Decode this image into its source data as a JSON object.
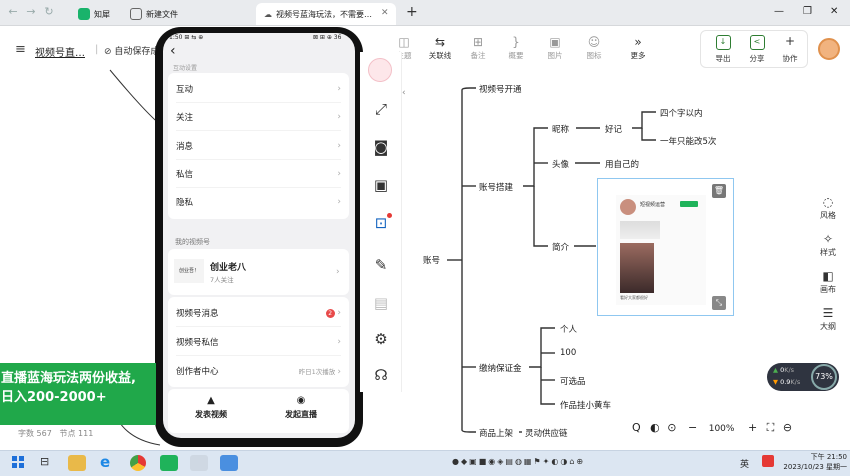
{
  "browser": {
    "tabs": [
      {
        "label": "知犀",
        "icon_color": "#19b36b"
      },
      {
        "label": "新建文件",
        "icon_color": "#666666"
      },
      {
        "label": "视频号蓝海玩法，不需要…",
        "icon_color": "#666666"
      }
    ],
    "new_tab": "+",
    "window_controls": [
      "—",
      "❐",
      "✕"
    ]
  },
  "doc": {
    "menu_icon": "≡",
    "title": "视频号直…",
    "saved": "自动保存成"
  },
  "toolbar": {
    "items": [
      {
        "label": "主题",
        "glyph": "◫"
      },
      {
        "label": "关联线",
        "glyph": "⇆"
      },
      {
        "label": "备注",
        "glyph": "⊞"
      },
      {
        "label": "概要",
        "glyph": "}"
      },
      {
        "label": "图片",
        "glyph": "▣"
      },
      {
        "label": "图标",
        "glyph": "☺"
      },
      {
        "label": "更多",
        "glyph": "»"
      }
    ],
    "right": [
      {
        "label": "导出",
        "glyph": "↓"
      },
      {
        "label": "分享",
        "glyph": "<"
      },
      {
        "label": "协作",
        "glyph": "+"
      }
    ]
  },
  "phone": {
    "status_left": "1:50 ⊞ ⇆ ⊕",
    "status_right": "⊠ ⊞ ⊕ 36",
    "back": "‹",
    "section_top": "互动设置",
    "rows1": [
      "互动",
      "关注",
      "消息",
      "私信",
      "隐私"
    ],
    "section_label": "我的视频号",
    "account": {
      "name": "创业老八",
      "followers": "7人关注",
      "logo": "创业吾！"
    },
    "rows2": [
      {
        "label": "视频号消息",
        "badge": "2",
        "right": ""
      },
      {
        "label": "视频号私信",
        "badge": "",
        "right": ""
      },
      {
        "label": "创作者中心",
        "badge": "",
        "right": "昨日1次播放"
      }
    ],
    "bottom": [
      {
        "label": "发表视频",
        "glyph": "▲"
      },
      {
        "label": "发起直播",
        "glyph": "◉"
      }
    ]
  },
  "mindmap": {
    "root": "账号",
    "branches": [
      "视频号开通",
      "账号搭建",
      "缴纳保证金",
      "商品上架"
    ],
    "sub": {
      "nickname": "昵称",
      "nickname_tip": "好记",
      "nick_a": "四个字以内",
      "nick_b": "一年只能改5次",
      "avatar": "头像",
      "avatar_tip": "用自己的",
      "intro": "简介"
    },
    "deposit": [
      "个人",
      "100",
      "可选品",
      "作品挂小黄车"
    ],
    "listing": "灵动供应链",
    "card_caption": "短视频运营",
    "card_line": "看好大家都很好"
  },
  "right_panel": [
    {
      "label": "风格",
      "glyph": "◌"
    },
    {
      "label": "样式",
      "glyph": "✧"
    },
    {
      "label": "画布",
      "glyph": "◧"
    },
    {
      "label": "大纲",
      "glyph": "☰"
    }
  ],
  "net": {
    "up": "0",
    "down": "0.9",
    "unit": "K/s",
    "percent": "73%"
  },
  "bottom_tools": {
    "zoom": "100%",
    "minus": "−",
    "plus": "+"
  },
  "stats": {
    "chars_label": "字数",
    "chars": "567",
    "nodes_label": "节点",
    "nodes": "111"
  },
  "banner": {
    "line1": "直播蓝海玩法两份收益,",
    "line2": "日入200-2000+"
  },
  "taskbar": {
    "time": "下午 21:50",
    "date": "2023/10/23 星期一",
    "lang": "英"
  }
}
